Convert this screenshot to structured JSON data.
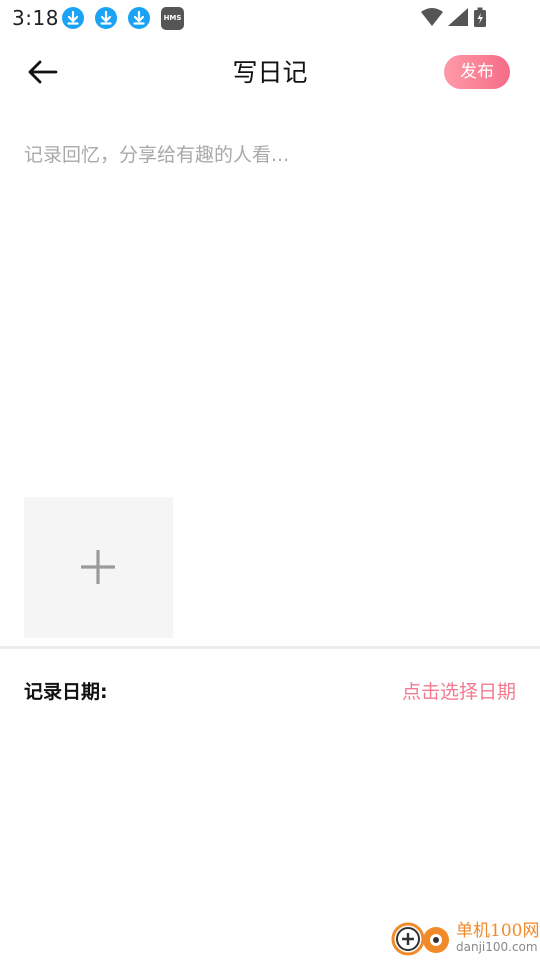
{
  "status_bar": {
    "time": "3:18",
    "notification_icons": [
      "download-icon",
      "download-icon",
      "download-icon",
      "hms-icon"
    ],
    "hms_label": "HMS",
    "system_icons": [
      "wifi-icon",
      "signal-icon",
      "battery-charging-icon"
    ]
  },
  "header": {
    "back_icon": "arrow-left-icon",
    "title": "写日记",
    "publish_label": "发布"
  },
  "editor": {
    "placeholder": "记录回忆，分享给有趣的人看...",
    "value": ""
  },
  "add_image": {
    "icon": "plus-icon"
  },
  "date_row": {
    "label": "记录日期:",
    "picker_text": "点击选择日期"
  },
  "watermark": {
    "name_cn": "单机100网",
    "domain": "danji100.com"
  },
  "colors": {
    "accent": "#f56c86",
    "notification": "#1aa3f5",
    "placeholder": "#a9a9a9",
    "tile_bg": "#f5f5f5"
  }
}
